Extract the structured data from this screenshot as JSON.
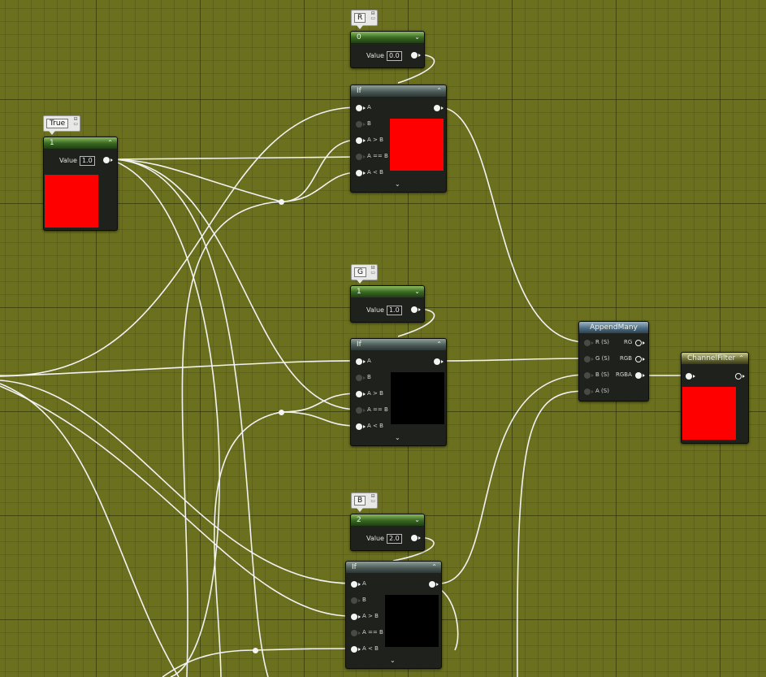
{
  "comments": {
    "true": "True",
    "r": "R",
    "g": "G",
    "b": "B"
  },
  "const_true": {
    "title": "1",
    "value_label": "Value",
    "value": "1.0",
    "preview_color": "#ff0000"
  },
  "const_r": {
    "title": "0",
    "value_label": "Value",
    "value": "0.0"
  },
  "const_g": {
    "title": "1",
    "value_label": "Value",
    "value": "1.0"
  },
  "const_b": {
    "title": "2",
    "value_label": "Value",
    "value": "2.0"
  },
  "if_node": {
    "title": "If",
    "pins": [
      "A",
      "B",
      "A > B",
      "A == B",
      "A < B"
    ]
  },
  "if_r": {
    "preview_color": "#ff0000"
  },
  "if_g": {
    "preview_color": "#000000"
  },
  "if_b": {
    "preview_color": "#000000"
  },
  "append": {
    "title": "AppendMany",
    "inputs": [
      "R (S)",
      "G (S)",
      "B (S)",
      "A (S)"
    ],
    "outputs": [
      "RG",
      "RGB",
      "RGBA"
    ]
  },
  "channel_filter": {
    "title": "ChannelFilter",
    "preview_color": "#ff0000"
  },
  "colors": {
    "wire": "#f2f2f2",
    "grid": "#6b701e",
    "node_bg": "#1f211c"
  },
  "icons": {
    "collapse": "chevron-up-icon",
    "expand": "chevron-down-icon",
    "comment_pin": "comment-options-icon"
  }
}
